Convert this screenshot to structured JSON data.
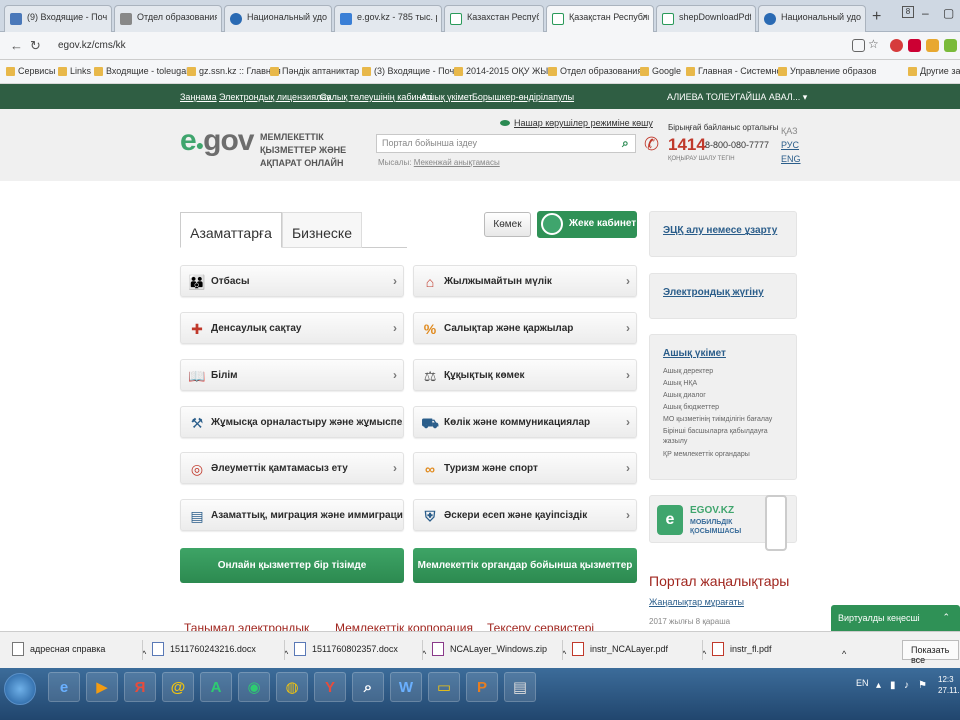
{
  "browser": {
    "tabs": [
      {
        "title": "(9) Входящие - Почта Ма",
        "favicon": "mail-icon"
      },
      {
        "title": "Отдел образования горс",
        "favicon": "page-icon"
      },
      {
        "title": "Национальный удостовер",
        "favicon": "shield-icon"
      },
      {
        "title": "e.gov.kz - 785 тыс. резуль",
        "favicon": "search-icon"
      },
      {
        "title": "Казахстан Республикась",
        "favicon": "egov-icon"
      },
      {
        "title": "Қазақстан Республикас",
        "favicon": "egov-icon"
      },
      {
        "title": "shepDownloadPdf",
        "favicon": "egov-icon"
      },
      {
        "title": "Национальный удостове",
        "favicon": "shield-icon"
      }
    ],
    "url": "egov.kz/cms/kk",
    "bookmarks": [
      "Сервисы",
      "Links",
      "Входящие - toleugal",
      "gz.ssn.kz :: Главная",
      "Пәндік аптаниктар",
      "(3) Входящие - Почта",
      "2014-2015 ОҚУ ЖЫЛ",
      "Отдел образования",
      "Google",
      "Главная - Системно",
      "Управление образов",
      "Другие закладки"
    ]
  },
  "egov": {
    "toplinks": [
      "Заңнама",
      "Электрондық лицензиялау",
      "Салық төлеушінің кабинеті",
      "Ашық үкімет",
      "Борышкер-өндірілапулы"
    ],
    "user": "АЛИЕВА ТОЛЕУГАЙША АВАЛ...",
    "logo_e": "e",
    "logo_gov": "gov",
    "tagline": "МЕМЛЕКЕТТІК ҚЫЗМЕТТЕР ЖӘНЕ АҚПАРАТ ОНЛАЙН",
    "search_placeholder": "Портал бойынша іздеу",
    "example_label": "Мысалы:",
    "example_link": "Мекенжай анықтамасы",
    "low_vision": "Нашар көрушілер режиміне көшу",
    "contact_title": "Бірыңғай байланыс орталығы",
    "contact_number": "1414",
    "contact_free": "8-800-080-7777",
    "contact_sub": "ҚОҢЫРАУ ШАЛУ ТЕГІН",
    "langs": [
      "ҚАЗ",
      "РУС",
      "ENG"
    ],
    "tabs": [
      "Азаматтарға",
      "Бизнеске"
    ],
    "help": "Көмек",
    "cabinet": "Жеке кабинет",
    "services_left": [
      "Отбасы",
      "Денсаулық сақтау",
      "Білім",
      "Жұмысқа орналастыру және жұмыспе...",
      "Әлеуметтік қамтамасыз ету",
      "Азаматтық, миграция және иммиграция"
    ],
    "services_right": [
      "Жылжымайтын мүлік",
      "Салықтар және қаржылар",
      "Құқықтық көмек",
      "Көлік және коммуникациялар",
      "Туризм және спорт",
      "Әскери есеп және қауіпсіздік"
    ],
    "cta_left": "Онлайн қызметтер бір тізімде",
    "cta_right": "Мемлекеттік органдар бойынша қызметтер",
    "right_links": [
      "ЭЦҚ алу немесе ұзарту",
      "Электрондық жүгіну",
      "Ашық үкімет"
    ],
    "open_gov": [
      "Ашық деректер",
      "Ашық НҚА",
      "Ашық диалог",
      "Ашық бюджеттер",
      "МО қызметінің тиімділігін бағалау",
      "Бірінші басшыларға қабылдауға",
      "жазылу",
      "ҚР мемлекеттік органдары"
    ],
    "app_title": "EGOV.KZ",
    "app_sub": [
      "МОБИЛЬДІК",
      "ҚОСЫМШАСЫ"
    ],
    "news_title": "Портал жаңалықтары",
    "news_archive": "Жаңалықтар мұрағаты",
    "news_date": "2017 жылғы 8 қараша",
    "bottom_links": [
      "Танымал электрондық",
      "Мемлекеттік корпорация",
      "Тексеру сервистері"
    ],
    "virtual": "Виртуалды кеңесші"
  },
  "downloads": [
    "адресная справка",
    "1511760243216.docx",
    "1511760802357.docx",
    "NCALayer_Windows.zip",
    "instr_NCALayer.pdf",
    "instr_fl.pdf"
  ],
  "show_all": "Показать все",
  "tray": {
    "lang": "EN",
    "time": "12:3",
    "date": "27.11.2"
  }
}
